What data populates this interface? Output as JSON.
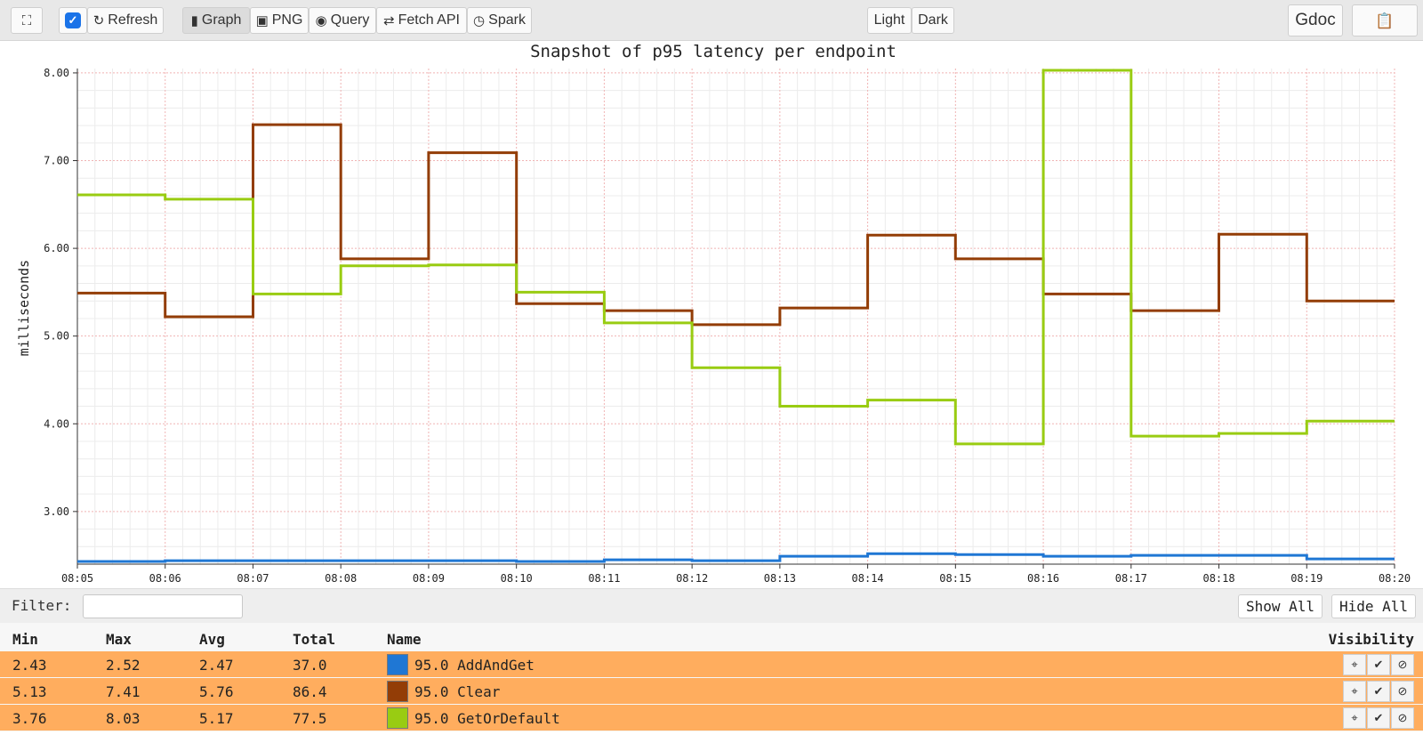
{
  "toolbar": {
    "fullscreen_icon": "expand-icon",
    "checkbox_checked": true,
    "refresh_label": "Refresh",
    "graph_label": "Graph",
    "png_label": "PNG",
    "query_label": "Query",
    "fetch_api_label": "Fetch API",
    "spark_label": "Spark",
    "light_label": "Light",
    "dark_label": "Dark",
    "gdoc_label": "Gdoc",
    "clipboard_icon": "clipboard-icon"
  },
  "chart_data": {
    "type": "line",
    "step": true,
    "title": "Snapshot of p95 latency per endpoint",
    "xlabel": "",
    "ylabel": "milliseconds",
    "ylim": [
      2.4,
      8.05
    ],
    "yticks": [
      "3.00",
      "4.00",
      "5.00",
      "6.00",
      "7.00",
      "8.00"
    ],
    "x": [
      "08:05",
      "08:06",
      "08:07",
      "08:08",
      "08:09",
      "08:10",
      "08:11",
      "08:12",
      "08:13",
      "08:14",
      "08:15",
      "08:16",
      "08:17",
      "08:18",
      "08:19",
      "08:20"
    ],
    "grid": true,
    "series": [
      {
        "name": "95.0 AddAndGet",
        "color": "#1f77d4",
        "values": [
          2.43,
          2.44,
          2.44,
          2.44,
          2.44,
          2.43,
          2.45,
          2.44,
          2.49,
          2.52,
          2.51,
          2.49,
          2.5,
          2.5,
          2.46,
          2.46
        ]
      },
      {
        "name": "95.0 Clear",
        "color": "#933d06",
        "values": [
          5.49,
          5.22,
          7.41,
          5.88,
          7.09,
          5.37,
          5.29,
          5.13,
          5.32,
          6.15,
          5.88,
          5.48,
          5.29,
          6.16,
          5.4,
          5.4
        ]
      },
      {
        "name": "95.0 GetOrDefault",
        "color": "#99cc12",
        "values": [
          6.61,
          6.56,
          5.48,
          5.8,
          5.81,
          5.5,
          5.15,
          4.64,
          4.2,
          4.27,
          3.77,
          8.03,
          3.86,
          3.89,
          4.03,
          4.03
        ]
      }
    ]
  },
  "filter": {
    "label": "Filter:",
    "value": "",
    "show_all_label": "Show All",
    "hide_all_label": "Hide All"
  },
  "table": {
    "headers": {
      "min": "Min",
      "max": "Max",
      "avg": "Avg",
      "total": "Total",
      "name": "Name",
      "visibility": "Visibility"
    },
    "rows": [
      {
        "min": "2.43",
        "max": "2.52",
        "avg": "2.47",
        "total": "37.0",
        "name": "95.0 AddAndGet",
        "color": "#1f77d4"
      },
      {
        "min": "5.13",
        "max": "7.41",
        "avg": "5.76",
        "total": "86.4",
        "name": "95.0 Clear",
        "color": "#933d06"
      },
      {
        "min": "3.76",
        "max": "8.03",
        "avg": "5.17",
        "total": "77.5",
        "name": "95.0 GetOrDefault",
        "color": "#99cc12"
      }
    ],
    "row_highlight": "#ffad5e"
  }
}
